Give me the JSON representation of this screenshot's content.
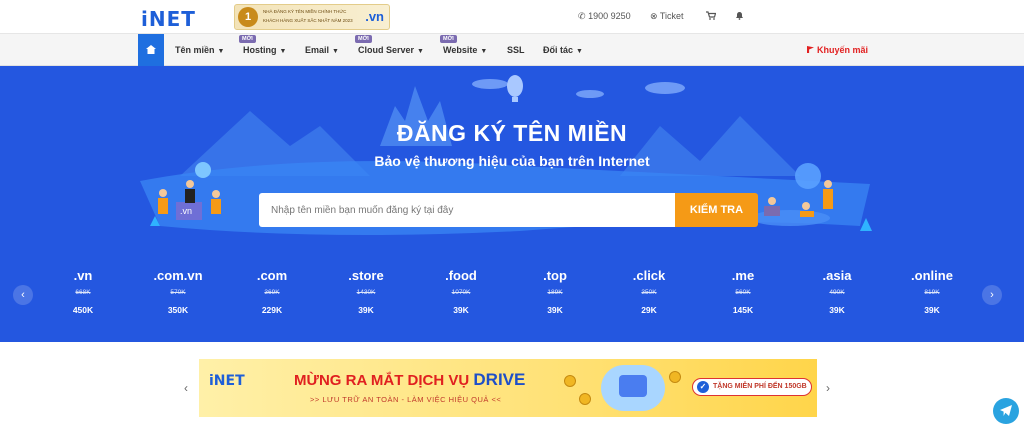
{
  "brand": {
    "logo": "iNET",
    "accent": "#2457e0",
    "orange": "#f59a16"
  },
  "award": {
    "number": "1",
    "line1": "NHÀ ĐĂNG KÝ TÊN MIỀN CHÍNH THỨC",
    "line2": "KHÁCH HÀNG XUẤT SẮC NHẤT NĂM 2023",
    "tld": ".vn"
  },
  "topbar": {
    "phone": "1900 9250",
    "ticket": "Ticket"
  },
  "nav": {
    "items": [
      {
        "label": "Tên miền",
        "badge": ""
      },
      {
        "label": "Hosting",
        "badge": "MỚI"
      },
      {
        "label": "Email",
        "badge": ""
      },
      {
        "label": "Cloud Server",
        "badge": "MỚI"
      },
      {
        "label": "Website",
        "badge": "MỚI"
      },
      {
        "label": "SSL",
        "badge": ""
      },
      {
        "label": "Đối tác",
        "badge": ""
      }
    ],
    "promo": "Khuyến mãi"
  },
  "hero": {
    "title": "ĐĂNG KÝ TÊN MIỀN",
    "subtitle": "Bảo vệ thương hiệu của bạn trên Internet",
    "search_placeholder": "Nhập tên miền bạn muốn đăng ký tại đây",
    "search_button": "KIỂM TRA",
    "sign_text": ".vn"
  },
  "domains": [
    {
      "ext": ".vn",
      "old": "668K",
      "new": "450K"
    },
    {
      "ext": ".com.vn",
      "old": "570K",
      "new": "350K"
    },
    {
      "ext": ".com",
      "old": "369K",
      "new": "229K"
    },
    {
      "ext": ".store",
      "old": "1430K",
      "new": "39K"
    },
    {
      "ext": ".food",
      "old": "1070K",
      "new": "39K"
    },
    {
      "ext": ".top",
      "old": "189K",
      "new": "39K"
    },
    {
      "ext": ".click",
      "old": "350K",
      "new": "29K"
    },
    {
      "ext": ".me",
      "old": "560K",
      "new": "145K"
    },
    {
      "ext": ".asia",
      "old": "490K",
      "new": "39K"
    },
    {
      "ext": ".online",
      "old": "819K",
      "new": "39K"
    }
  ],
  "banner": {
    "logo": "iNET",
    "headline_part1": "MỪNG RA MẮT DỊCH VỤ",
    "headline_part2": "DRIVE",
    "tagline": ">> LƯU TRỮ AN TOÀN - LÀM VIỆC HIỆU QUẢ <<",
    "free_offer": "TẶNG MIỄN PHÍ ĐẾN 150GB"
  },
  "icons": {
    "phone": "phone-icon",
    "ticket": "ticket-icon",
    "cart": "cart-icon",
    "bell": "bell-icon",
    "home": "home-icon",
    "promo": "flag-icon",
    "telegram": "telegram-icon"
  }
}
